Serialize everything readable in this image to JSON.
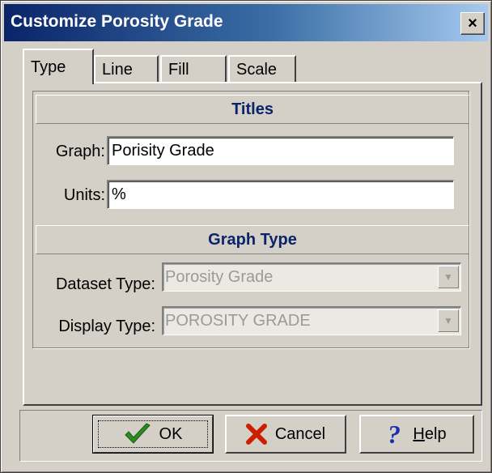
{
  "window": {
    "title": "Customize Porosity Grade",
    "close_label": "×"
  },
  "tabs": [
    {
      "label": "Type",
      "active": true
    },
    {
      "label": "Line",
      "active": false
    },
    {
      "label": "Fill",
      "active": false
    },
    {
      "label": "Scale",
      "active": false
    }
  ],
  "titles_section": {
    "heading": "Titles",
    "graph_label": "Graph:",
    "graph_value": "Porisity Grade",
    "units_label": "Units:",
    "units_value": "%"
  },
  "graph_type_section": {
    "heading": "Graph Type",
    "dataset_type_label": "Dataset Type:",
    "dataset_type_value": "Porosity Grade",
    "display_type_label": "Display Type:",
    "display_type_value": "POROSITY GRADE"
  },
  "buttons": {
    "ok_label": "OK",
    "cancel_label": "Cancel",
    "help_prefix": "H",
    "help_suffix": "elp"
  },
  "icons": {
    "ok": "checkmark-icon",
    "cancel": "x-icon",
    "help": "question-mark-icon"
  },
  "colors": {
    "title_bar_start": "#0a246a",
    "title_bar_end": "#a6caf0",
    "section_heading": "#0a246a",
    "ok_check": "#2e8b22",
    "cancel_x": "#cc1f00",
    "help_mark": "#1a2fb0"
  }
}
